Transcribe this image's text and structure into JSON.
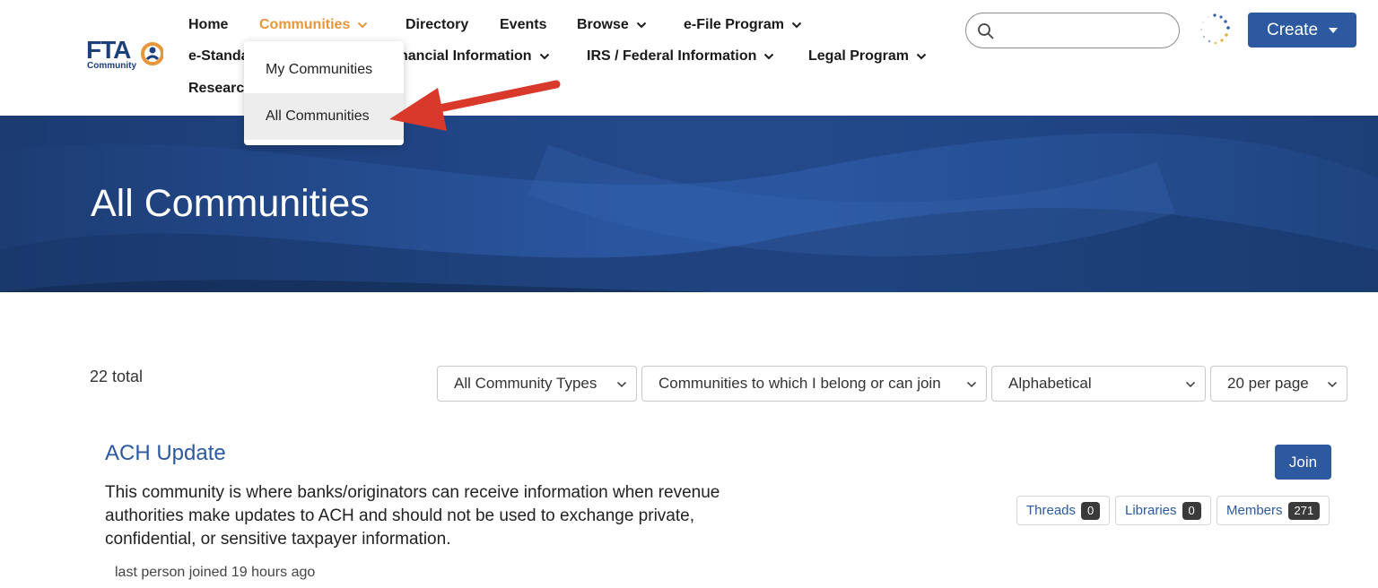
{
  "logo": {
    "text": "FTA",
    "subtext": "Community"
  },
  "nav": {
    "home": "Home",
    "communities": "Communities",
    "directory": "Directory",
    "events": "Events",
    "browse": "Browse",
    "efile": "e-File Program",
    "estandards": "e-Standa",
    "financial": "nancial Information",
    "irs": "IRS / Federal Information",
    "legal": "Legal Program",
    "research": "Researc"
  },
  "search": {
    "placeholder": ""
  },
  "create_label": "Create",
  "dropdown": {
    "items": [
      "My Communities",
      "All Communities"
    ]
  },
  "banner": {
    "title": "All Communities"
  },
  "listing": {
    "total": "22 total",
    "filters": {
      "type": "All Community Types",
      "membership": "Communities to which I belong or can join",
      "sort": "Alphabetical",
      "per_page": "20 per page"
    }
  },
  "community": {
    "title": "ACH Update",
    "description": "This community is where banks/originators can receive information when revenue authorities make updates to ACH and should not be used to exchange private, confidential, or sensitive taxpayer information.",
    "meta": "last person joined 19 hours ago",
    "join_label": "Join",
    "stats": {
      "threads_label": "Threads",
      "threads_count": "0",
      "libraries_label": "Libraries",
      "libraries_count": "0",
      "members_label": "Members",
      "members_count": "271"
    }
  },
  "colors": {
    "brand": "#2c59a0",
    "active_nav": "#e8963a",
    "arrow": "#d9392b",
    "banner_dark": "#1c3c73"
  }
}
